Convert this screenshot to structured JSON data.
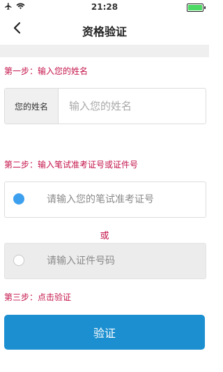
{
  "status_bar": {
    "time": "21:28"
  },
  "nav": {
    "title": "资格验证"
  },
  "step1": {
    "label": "第一步：输入您的姓名"
  },
  "name_field": {
    "label": "您的姓名",
    "placeholder": "输入您的姓名"
  },
  "step2": {
    "label": "第二步：输入笔试准考证号或证件号"
  },
  "exam_field": {
    "placeholder": "请输入您的笔试准考证号",
    "selected": true
  },
  "or_text": "或",
  "id_field": {
    "placeholder": "请输入证件号码",
    "selected": false
  },
  "step3": {
    "label": "第三步：点击验证"
  },
  "verify_button": {
    "label": "验证"
  },
  "colors": {
    "accent": "#1b8fd0",
    "step_text": "#c4144b",
    "radio_on": "#3da0ef"
  },
  "icons": [
    "airplane-icon",
    "wifi-icon",
    "battery-icon",
    "back-chevron-icon"
  ]
}
